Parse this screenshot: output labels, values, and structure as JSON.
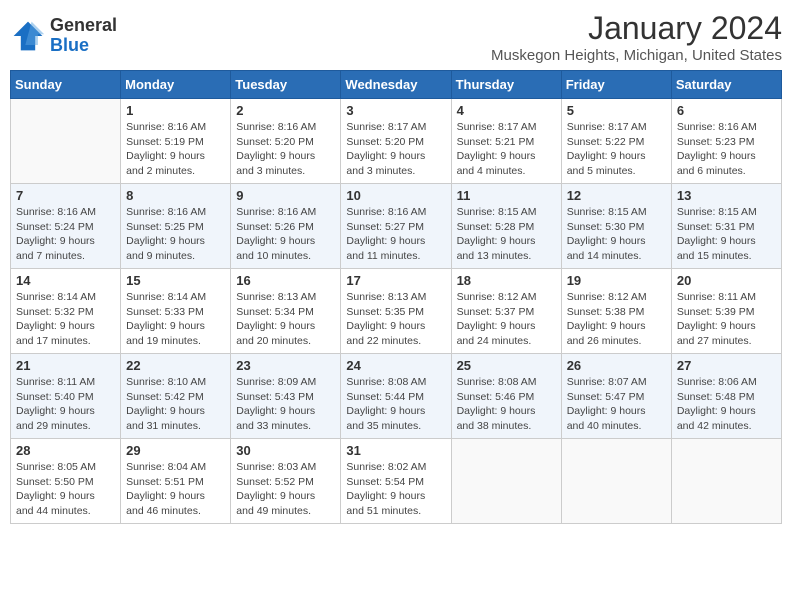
{
  "header": {
    "logo_line1": "General",
    "logo_line2": "Blue",
    "month": "January 2024",
    "location": "Muskegon Heights, Michigan, United States"
  },
  "days_of_week": [
    "Sunday",
    "Monday",
    "Tuesday",
    "Wednesday",
    "Thursday",
    "Friday",
    "Saturday"
  ],
  "weeks": [
    [
      {
        "day": "",
        "info": ""
      },
      {
        "day": "1",
        "info": "Sunrise: 8:16 AM\nSunset: 5:19 PM\nDaylight: 9 hours\nand 2 minutes."
      },
      {
        "day": "2",
        "info": "Sunrise: 8:16 AM\nSunset: 5:20 PM\nDaylight: 9 hours\nand 3 minutes."
      },
      {
        "day": "3",
        "info": "Sunrise: 8:17 AM\nSunset: 5:20 PM\nDaylight: 9 hours\nand 3 minutes."
      },
      {
        "day": "4",
        "info": "Sunrise: 8:17 AM\nSunset: 5:21 PM\nDaylight: 9 hours\nand 4 minutes."
      },
      {
        "day": "5",
        "info": "Sunrise: 8:17 AM\nSunset: 5:22 PM\nDaylight: 9 hours\nand 5 minutes."
      },
      {
        "day": "6",
        "info": "Sunrise: 8:16 AM\nSunset: 5:23 PM\nDaylight: 9 hours\nand 6 minutes."
      }
    ],
    [
      {
        "day": "7",
        "info": "Sunrise: 8:16 AM\nSunset: 5:24 PM\nDaylight: 9 hours\nand 7 minutes."
      },
      {
        "day": "8",
        "info": "Sunrise: 8:16 AM\nSunset: 5:25 PM\nDaylight: 9 hours\nand 9 minutes."
      },
      {
        "day": "9",
        "info": "Sunrise: 8:16 AM\nSunset: 5:26 PM\nDaylight: 9 hours\nand 10 minutes."
      },
      {
        "day": "10",
        "info": "Sunrise: 8:16 AM\nSunset: 5:27 PM\nDaylight: 9 hours\nand 11 minutes."
      },
      {
        "day": "11",
        "info": "Sunrise: 8:15 AM\nSunset: 5:28 PM\nDaylight: 9 hours\nand 13 minutes."
      },
      {
        "day": "12",
        "info": "Sunrise: 8:15 AM\nSunset: 5:30 PM\nDaylight: 9 hours\nand 14 minutes."
      },
      {
        "day": "13",
        "info": "Sunrise: 8:15 AM\nSunset: 5:31 PM\nDaylight: 9 hours\nand 15 minutes."
      }
    ],
    [
      {
        "day": "14",
        "info": "Sunrise: 8:14 AM\nSunset: 5:32 PM\nDaylight: 9 hours\nand 17 minutes."
      },
      {
        "day": "15",
        "info": "Sunrise: 8:14 AM\nSunset: 5:33 PM\nDaylight: 9 hours\nand 19 minutes."
      },
      {
        "day": "16",
        "info": "Sunrise: 8:13 AM\nSunset: 5:34 PM\nDaylight: 9 hours\nand 20 minutes."
      },
      {
        "day": "17",
        "info": "Sunrise: 8:13 AM\nSunset: 5:35 PM\nDaylight: 9 hours\nand 22 minutes."
      },
      {
        "day": "18",
        "info": "Sunrise: 8:12 AM\nSunset: 5:37 PM\nDaylight: 9 hours\nand 24 minutes."
      },
      {
        "day": "19",
        "info": "Sunrise: 8:12 AM\nSunset: 5:38 PM\nDaylight: 9 hours\nand 26 minutes."
      },
      {
        "day": "20",
        "info": "Sunrise: 8:11 AM\nSunset: 5:39 PM\nDaylight: 9 hours\nand 27 minutes."
      }
    ],
    [
      {
        "day": "21",
        "info": "Sunrise: 8:11 AM\nSunset: 5:40 PM\nDaylight: 9 hours\nand 29 minutes."
      },
      {
        "day": "22",
        "info": "Sunrise: 8:10 AM\nSunset: 5:42 PM\nDaylight: 9 hours\nand 31 minutes."
      },
      {
        "day": "23",
        "info": "Sunrise: 8:09 AM\nSunset: 5:43 PM\nDaylight: 9 hours\nand 33 minutes."
      },
      {
        "day": "24",
        "info": "Sunrise: 8:08 AM\nSunset: 5:44 PM\nDaylight: 9 hours\nand 35 minutes."
      },
      {
        "day": "25",
        "info": "Sunrise: 8:08 AM\nSunset: 5:46 PM\nDaylight: 9 hours\nand 38 minutes."
      },
      {
        "day": "26",
        "info": "Sunrise: 8:07 AM\nSunset: 5:47 PM\nDaylight: 9 hours\nand 40 minutes."
      },
      {
        "day": "27",
        "info": "Sunrise: 8:06 AM\nSunset: 5:48 PM\nDaylight: 9 hours\nand 42 minutes."
      }
    ],
    [
      {
        "day": "28",
        "info": "Sunrise: 8:05 AM\nSunset: 5:50 PM\nDaylight: 9 hours\nand 44 minutes."
      },
      {
        "day": "29",
        "info": "Sunrise: 8:04 AM\nSunset: 5:51 PM\nDaylight: 9 hours\nand 46 minutes."
      },
      {
        "day": "30",
        "info": "Sunrise: 8:03 AM\nSunset: 5:52 PM\nDaylight: 9 hours\nand 49 minutes."
      },
      {
        "day": "31",
        "info": "Sunrise: 8:02 AM\nSunset: 5:54 PM\nDaylight: 9 hours\nand 51 minutes."
      },
      {
        "day": "",
        "info": ""
      },
      {
        "day": "",
        "info": ""
      },
      {
        "day": "",
        "info": ""
      }
    ]
  ]
}
